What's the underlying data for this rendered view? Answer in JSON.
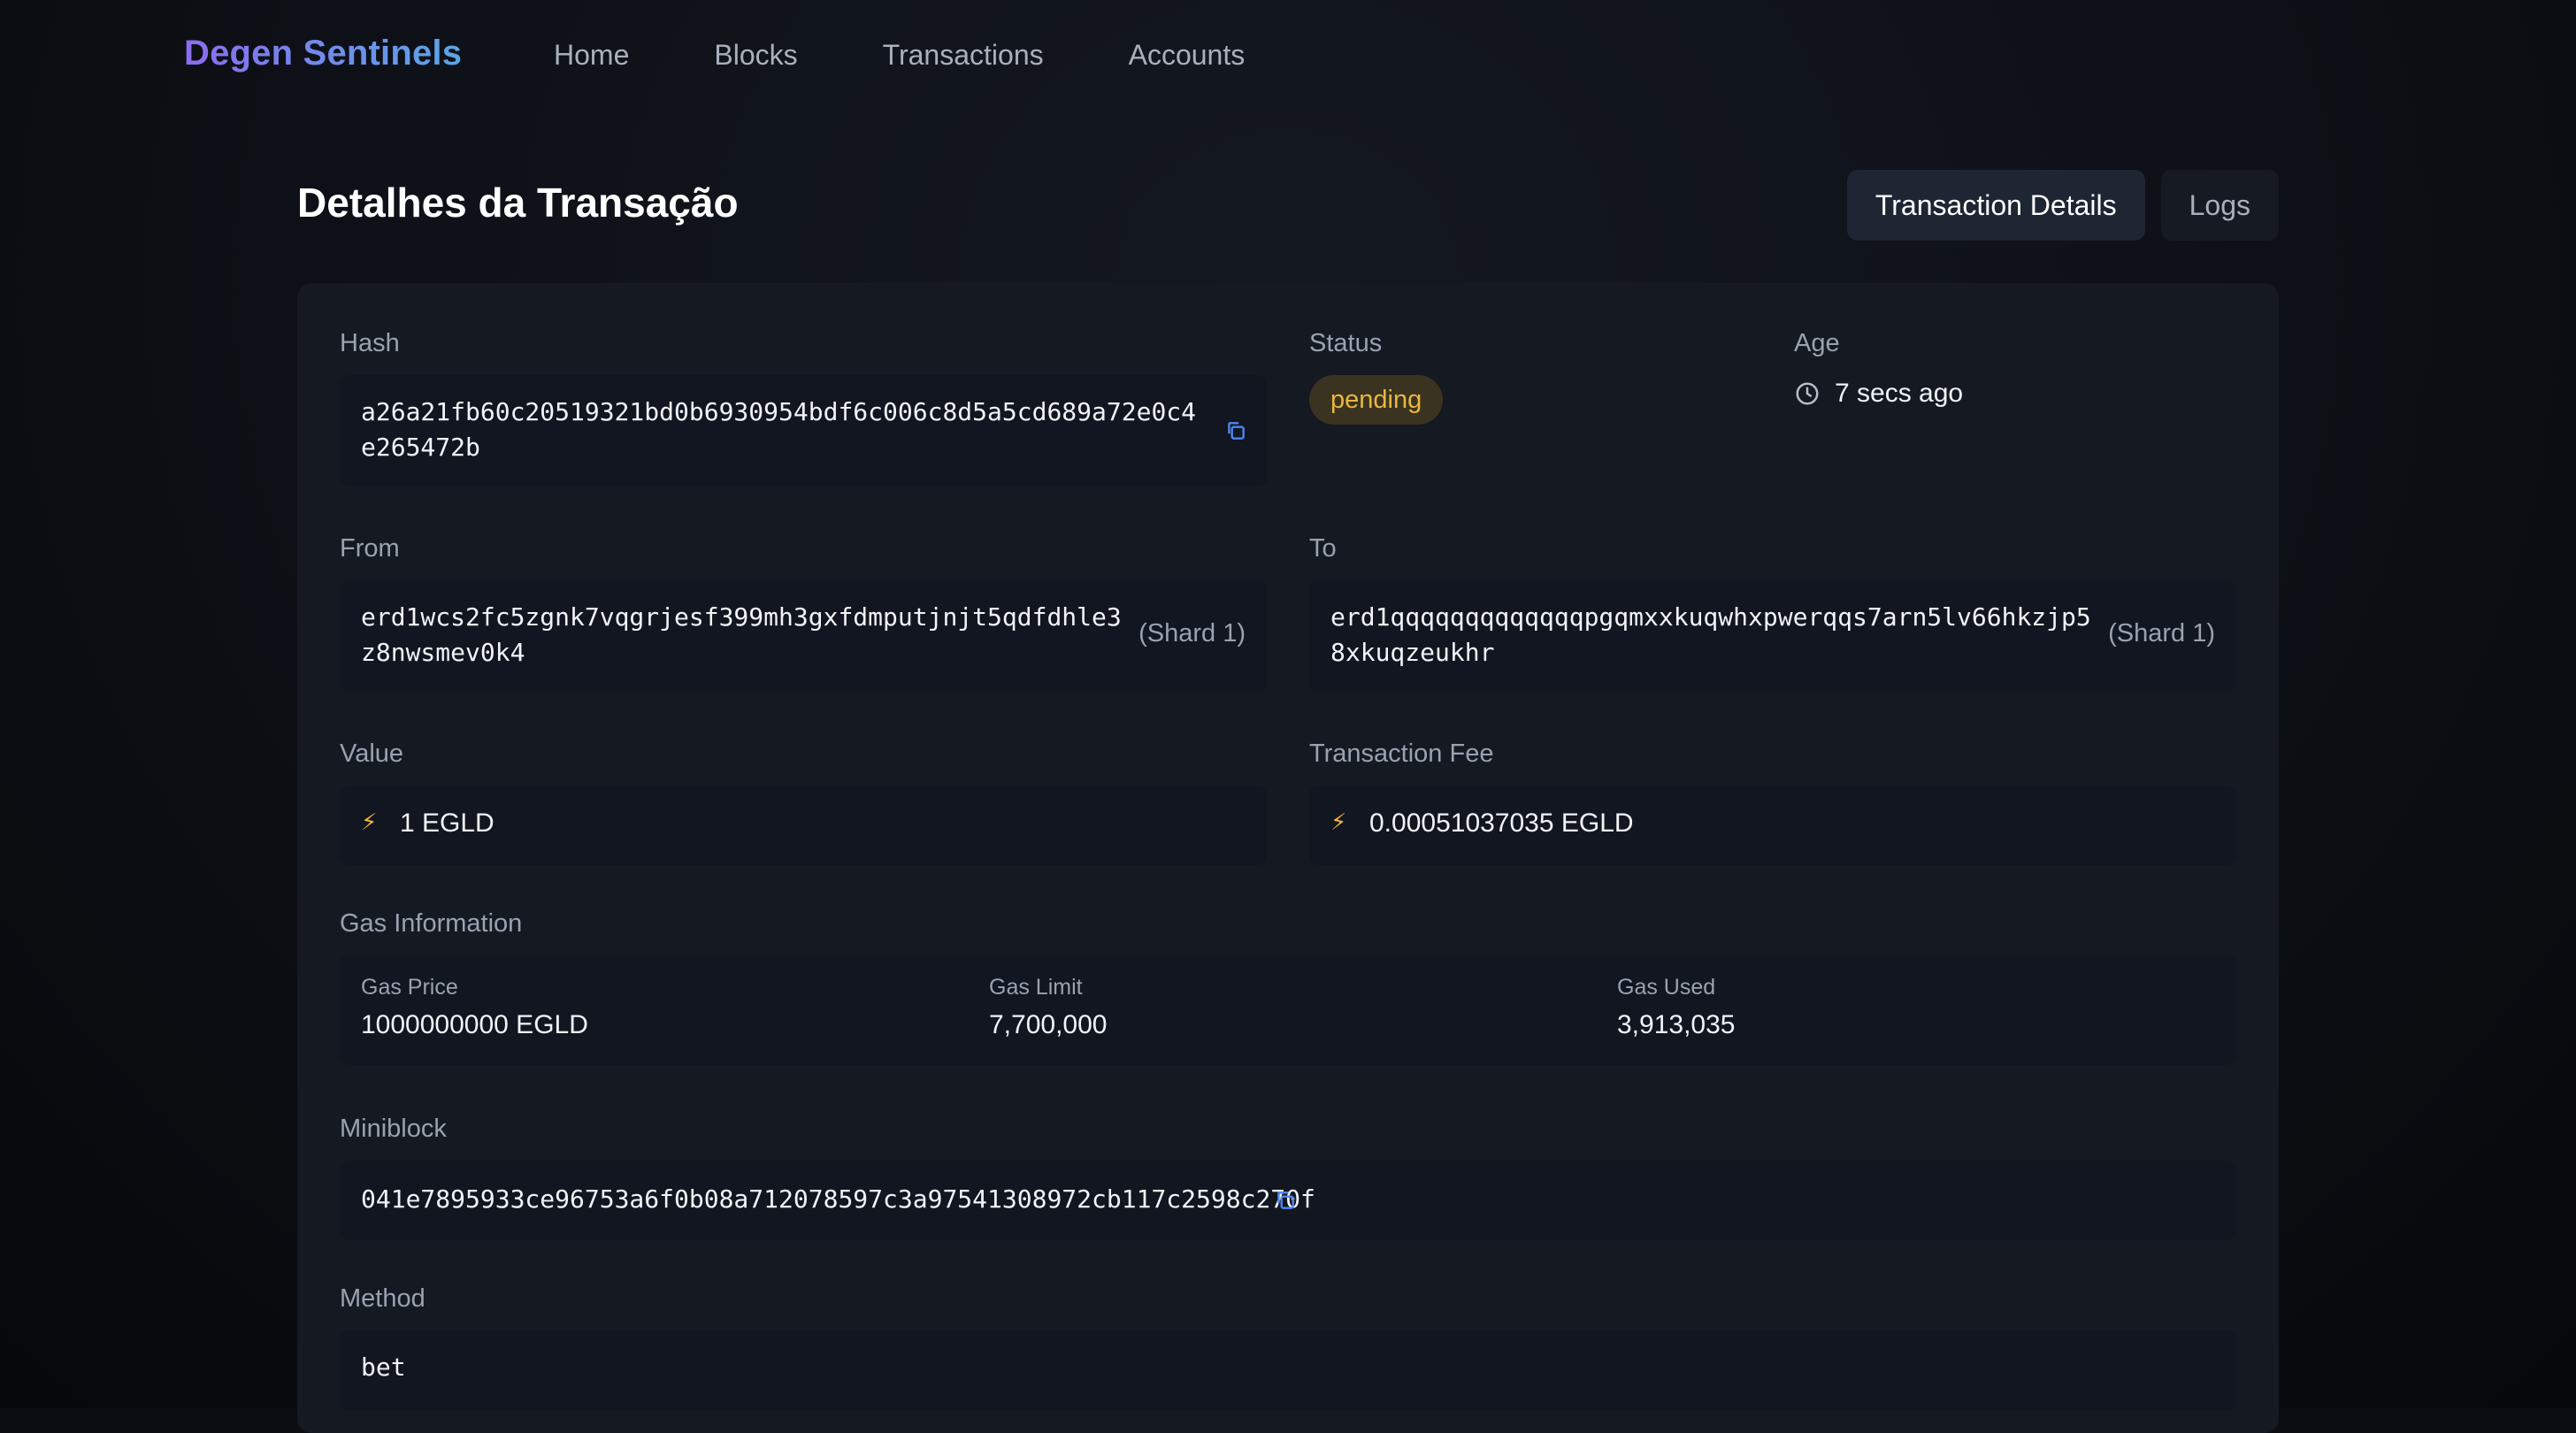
{
  "nav": {
    "brand": "Degen Sentinels",
    "links": [
      "Home",
      "Blocks",
      "Transactions",
      "Accounts"
    ]
  },
  "header": {
    "title": "Detalhes da Transação",
    "tabs": [
      "Transaction Details",
      "Logs"
    ]
  },
  "details": {
    "hash": {
      "label": "Hash",
      "line1": "a26a21fb60c20519321bd0b6930954bdf6c006c8d5a5cd689a72e0c4",
      "line2": "e265472b"
    },
    "status": {
      "label": "Status",
      "value": "pending"
    },
    "age": {
      "label": "Age",
      "value": "7 secs ago"
    },
    "from": {
      "label": "From",
      "line1": "erd1wcs2fc5zgnk7vqgrjesf399mh3gxfdmputjnjt5qdfdhle3",
      "line2": "z8nwsmev0k4",
      "shard": "(Shard 1)"
    },
    "to": {
      "label": "To",
      "line1": "erd1qqqqqqqqqqqqqpgqmxxkuqwhxpwerqqs7arn5lv66hkzjp5",
      "line2": "8xkuqzeukhr",
      "shard": "(Shard 1)"
    },
    "value": {
      "label": "Value",
      "amount": "1 EGLD"
    },
    "fee": {
      "label": "Transaction Fee",
      "amount": "0.00051037035 EGLD"
    },
    "gas": {
      "label": "Gas Information",
      "price_label": "Gas Price",
      "price": "1000000000 EGLD",
      "limit_label": "Gas Limit",
      "limit": "7,700,000",
      "used_label": "Gas Used",
      "used": "3,913,035"
    },
    "miniblock": {
      "label": "Miniblock",
      "value": "041e7895933ce96753a6f0b08a712078597c3a97541308972cb117c2598c270f"
    },
    "method": {
      "label": "Method",
      "value": "bet"
    }
  },
  "colors": {
    "accent_gradient_start": "#8b6cf0",
    "accent_gradient_end": "#5aa6e6",
    "status_pending": "#e9b73f",
    "copy_icon": "#4f86f0"
  }
}
